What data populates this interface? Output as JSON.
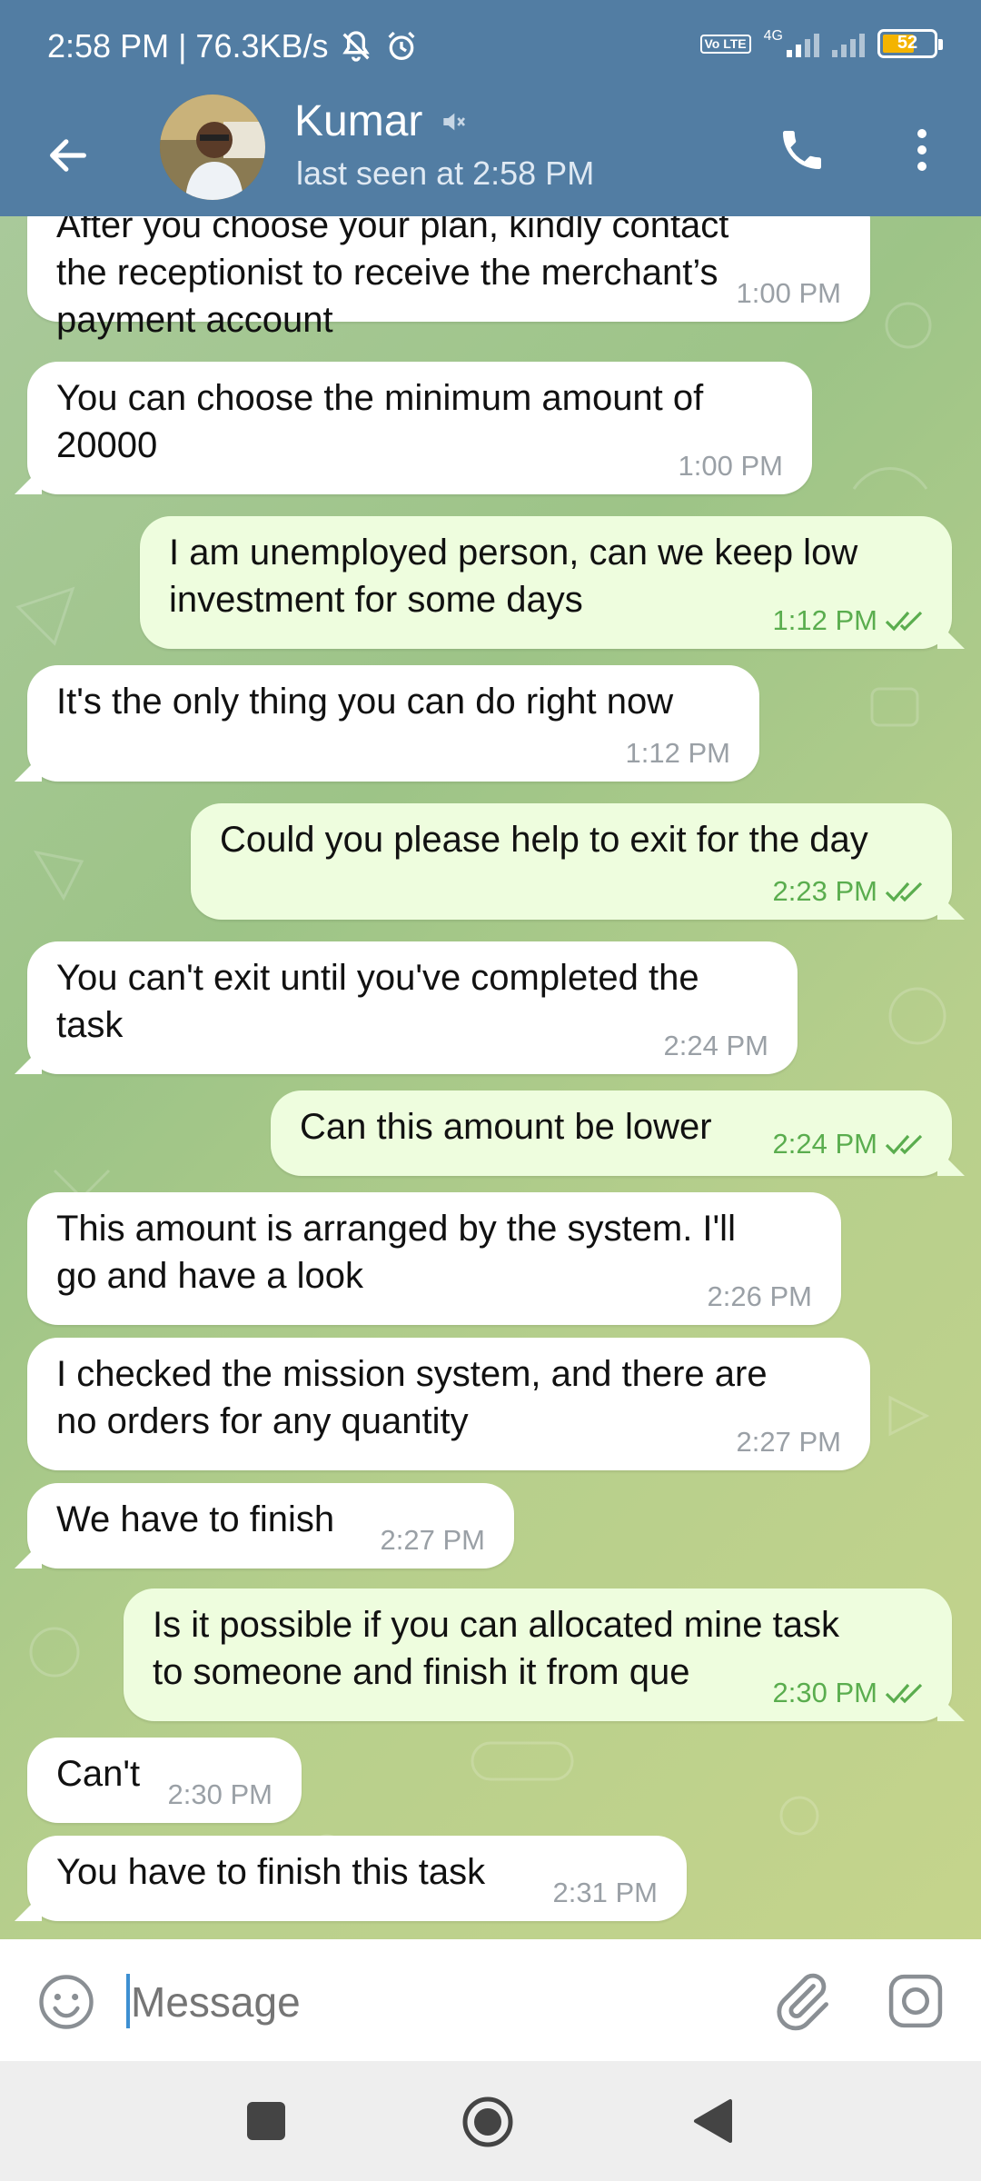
{
  "status_bar": {
    "time_speed": "2:58 PM | 76.3KB/s",
    "volte": "Vo LTE",
    "network": "4G",
    "battery": "52",
    "icons": [
      "mute-notifications-icon",
      "alarm-icon",
      "signal-icon",
      "battery-icon"
    ]
  },
  "header": {
    "contact_name": "Kumar",
    "last_seen": "last seen at 2:58 PM",
    "icons": [
      "back-arrow-icon",
      "muted-icon",
      "phone-icon",
      "more-vert-icon"
    ]
  },
  "messages": [
    {
      "direction": "in",
      "text": "After you choose your plan, kindly contact\nthe receptionist to receive the merchant’s\npayment account",
      "time": "1:00 PM"
    },
    {
      "direction": "in",
      "text": "You can choose the minimum amount of\n20000",
      "time": "1:00 PM"
    },
    {
      "direction": "out",
      "text": "I am unemployed person, can we keep low\ninvestment for some days",
      "time": "1:12 PM",
      "read": true
    },
    {
      "direction": "in",
      "text": "It's the only thing you can do right now",
      "time": "1:12 PM"
    },
    {
      "direction": "out",
      "text": "Could you please help to exit for the day",
      "time": "2:23 PM",
      "read": true
    },
    {
      "direction": "in",
      "text": "You can't exit until you've completed the\ntask",
      "time": "2:24 PM"
    },
    {
      "direction": "out",
      "text": "Can this amount be lower",
      "time": "2:24 PM",
      "read": true
    },
    {
      "direction": "in",
      "text": "This amount is arranged by the system. I'll\ngo and have a look",
      "time": "2:26 PM"
    },
    {
      "direction": "in",
      "text": "I checked the mission system, and there are\nno orders for any quantity",
      "time": "2:27 PM"
    },
    {
      "direction": "in",
      "text": "We have to finish",
      "time": "2:27 PM"
    },
    {
      "direction": "out",
      "text": "Is it possible if you can allocated mine task\nto someone and finish it from que",
      "time": "2:30 PM",
      "read": true
    },
    {
      "direction": "in",
      "text": "Can't",
      "time": "2:30 PM"
    },
    {
      "direction": "in",
      "text": "You have to finish this task",
      "time": "2:31 PM"
    }
  ],
  "composer": {
    "placeholder": "Message",
    "icons": [
      "emoji-icon",
      "attach-icon",
      "camera-icon"
    ]
  },
  "nav": {
    "icons": [
      "recents-icon",
      "home-icon",
      "back-icon"
    ]
  },
  "colors": {
    "header": "#527da3",
    "incoming_bubble": "#ffffff",
    "outgoing_bubble": "#eefdde",
    "outgoing_time": "#5aad4e",
    "caret": "#3d8fd1"
  }
}
